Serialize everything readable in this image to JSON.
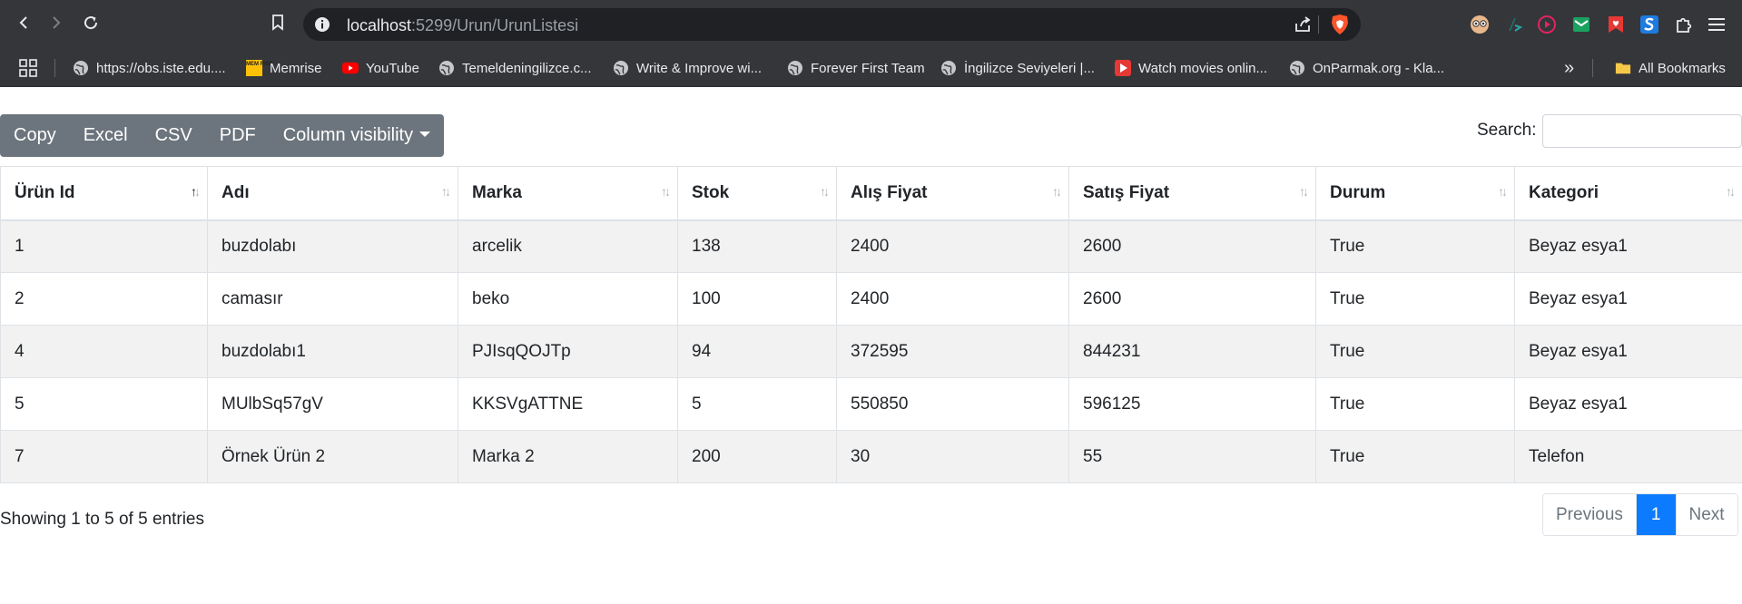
{
  "browser": {
    "url_host": "localhost",
    "url_rest": ":5299/Urun/UrunListesi",
    "bookmarks": [
      {
        "label": "https://obs.iste.edu....",
        "icon": "globe-icon"
      },
      {
        "label": "Memrise",
        "icon": "memrise-icon"
      },
      {
        "label": "YouTube",
        "icon": "youtube-icon"
      },
      {
        "label": "Temeldeningilizce.c...",
        "icon": "globe-icon"
      },
      {
        "label": "Write & Improve wi...",
        "icon": "globe-icon"
      },
      {
        "label": "Forever First Team",
        "icon": "globe-icon"
      },
      {
        "label": "İngilizce Seviyeleri |...",
        "icon": "globe-icon"
      },
      {
        "label": "Watch movies onlin...",
        "icon": "play-icon"
      },
      {
        "label": "OnParmak.org - Kla...",
        "icon": "globe-icon"
      }
    ],
    "more": "»",
    "all_bookmarks": "All Bookmarks",
    "memrise_badge": "MEM RISE"
  },
  "toolbar": {
    "copy": "Copy",
    "excel": "Excel",
    "csv": "CSV",
    "pdf": "PDF",
    "colvis": "Column visibility"
  },
  "search": {
    "label": "Search:",
    "value": ""
  },
  "table": {
    "headers": [
      "Ürün Id",
      "Adı",
      "Marka",
      "Stok",
      "Alış Fiyat",
      "Satış Fiyat",
      "Durum",
      "Kategori"
    ],
    "rows": [
      [
        "1",
        "buzdolabı",
        "arcelik",
        "138",
        "2400",
        "2600",
        "True",
        "Beyaz esya1"
      ],
      [
        "2",
        "camasır",
        "beko",
        "100",
        "2400",
        "2600",
        "True",
        "Beyaz esya1"
      ],
      [
        "4",
        "buzdolabı1",
        "PJIsqQOJTp",
        "94",
        "372595",
        "844231",
        "True",
        "Beyaz esya1"
      ],
      [
        "5",
        "MUlbSq57gV",
        "KKSVgATTNE",
        "5",
        "550850",
        "596125",
        "True",
        "Beyaz esya1"
      ],
      [
        "7",
        "Örnek Ürün 2",
        "Marka 2",
        "200",
        "30",
        "55",
        "True",
        "Telefon"
      ]
    ],
    "sort_glyph": "↑↓"
  },
  "footer": {
    "info": "Showing 1 to 5 of 5 entries",
    "previous": "Previous",
    "page": "1",
    "next": "Next"
  },
  "colors": {
    "chrome_bg": "#35363a",
    "address_bg": "#202124",
    "button_group": "#6c757d",
    "active_page": "#0d7bff",
    "stripe": "#f2f2f2"
  }
}
